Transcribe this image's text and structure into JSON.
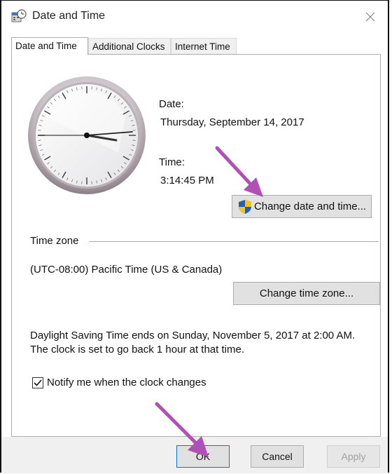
{
  "window": {
    "title": "Date and Time"
  },
  "tabs": [
    {
      "label": "Date and Time",
      "active": true
    },
    {
      "label": "Additional Clocks",
      "active": false
    },
    {
      "label": "Internet Time",
      "active": false
    }
  ],
  "datetime": {
    "date_label": "Date:",
    "date_value": "Thursday, September 14, 2017",
    "time_label": "Time:",
    "time_value": "3:14:45 PM",
    "change_button": "Change date and time..."
  },
  "timezone": {
    "group_label": "Time zone",
    "value": "(UTC-08:00) Pacific Time (US & Canada)",
    "change_button": "Change time zone..."
  },
  "dst": {
    "line1": "Daylight Saving Time ends on Sunday, November 5, 2017 at 2:00 AM.",
    "line2": "The clock is set to go back 1 hour at that time."
  },
  "notify": {
    "label": "Notify me when the clock changes",
    "checked": true
  },
  "footer": {
    "ok": "OK",
    "cancel": "Cancel",
    "apply": "Apply"
  },
  "icons": {
    "title": "date-time-app-icon",
    "close": "close-icon",
    "shield": "uac-shield-icon",
    "check": "checkmark-icon"
  },
  "colors": {
    "annotation_arrow": "#b04fb6",
    "default_button_border": "#0078d7"
  }
}
